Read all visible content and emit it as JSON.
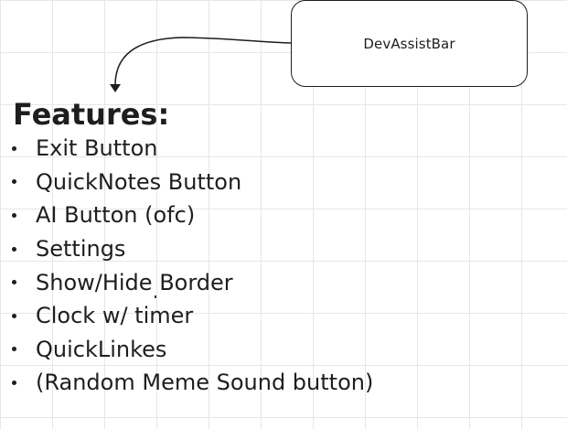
{
  "diagram": {
    "box_label": "DevAssistBar",
    "heading": "Features:",
    "features": [
      "Exit Button",
      "QuickNotes Button",
      "AI Button (ofc)",
      "Settings",
      "Show/Hide Border",
      "Clock w/ timer",
      "QuickLinkes",
      "(Random Meme Sound button)"
    ]
  },
  "colors": {
    "ink": "#1e1e1e",
    "grid": "#e6e6e6",
    "background": "#ffffff"
  }
}
